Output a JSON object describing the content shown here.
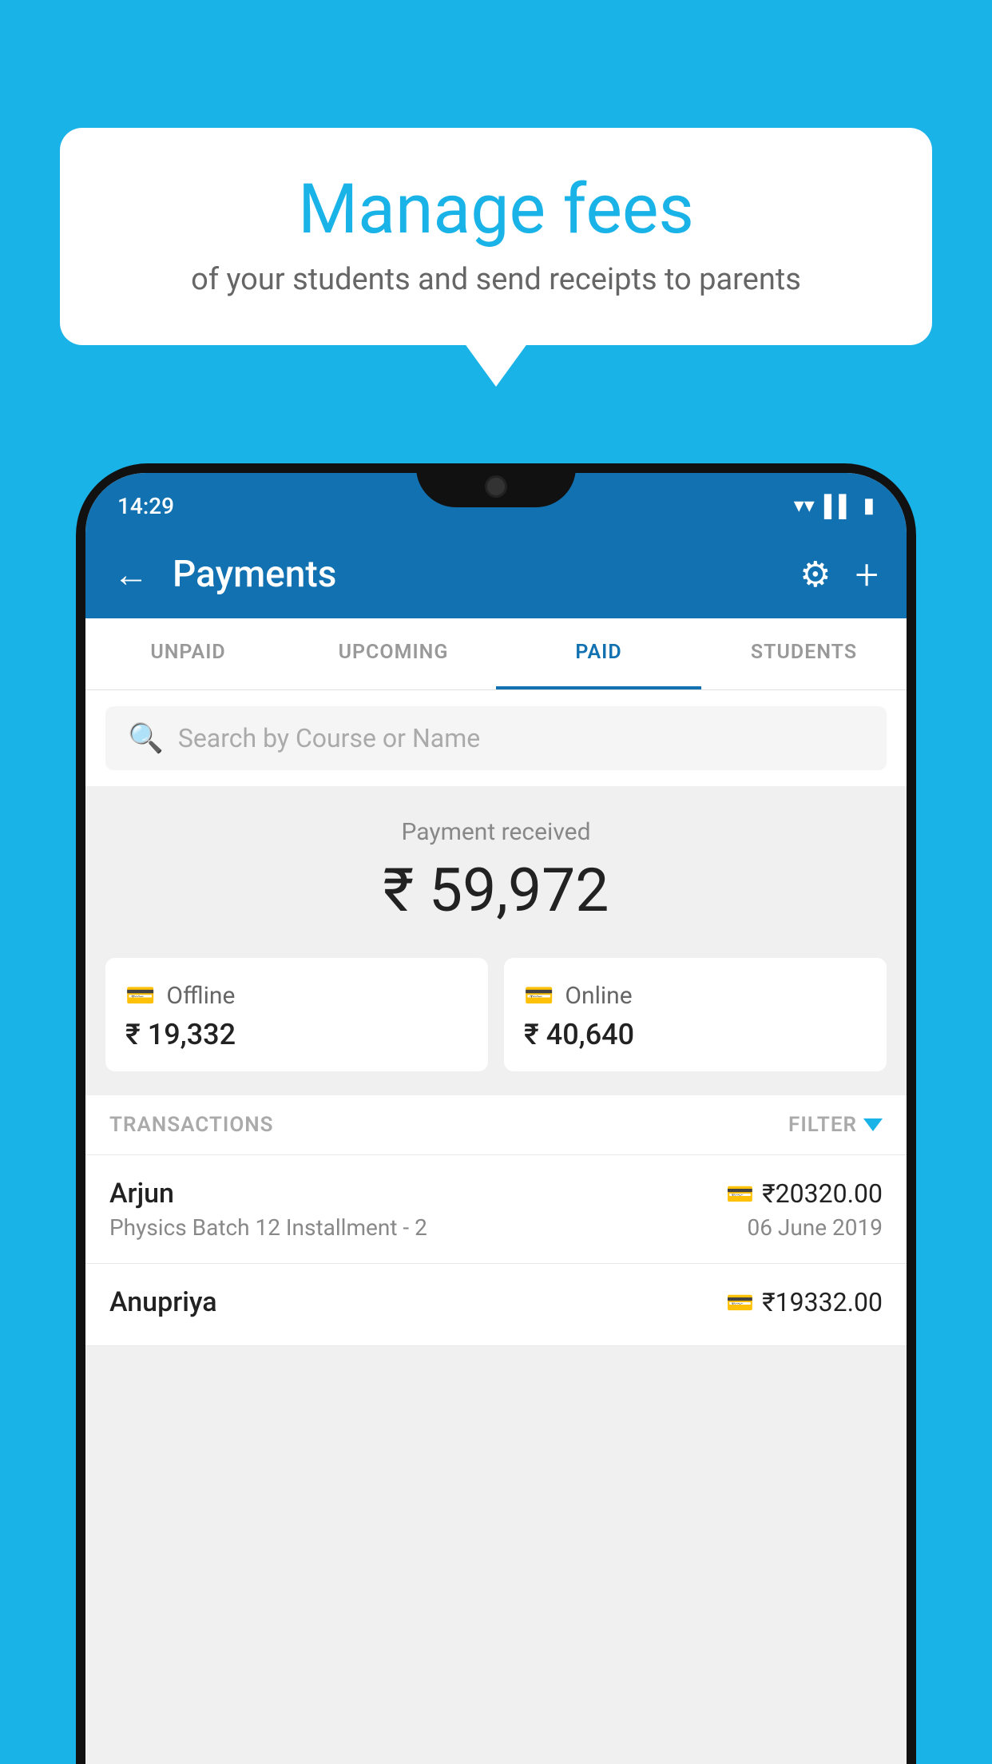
{
  "background_color": "#1ab3e8",
  "bubble": {
    "title": "Manage fees",
    "subtitle": "of your students and send receipts to parents"
  },
  "status_bar": {
    "time": "14:29",
    "icons": [
      "wifi",
      "signal",
      "battery"
    ]
  },
  "app_bar": {
    "title": "Payments",
    "back_label": "←",
    "gear_label": "⚙",
    "plus_label": "+"
  },
  "tabs": [
    {
      "label": "UNPAID",
      "active": false
    },
    {
      "label": "UPCOMING",
      "active": false
    },
    {
      "label": "PAID",
      "active": true
    },
    {
      "label": "STUDENTS",
      "active": false
    }
  ],
  "search": {
    "placeholder": "Search by Course or Name"
  },
  "payment_received": {
    "label": "Payment received",
    "amount": "₹ 59,972"
  },
  "payment_cards": [
    {
      "type": "Offline",
      "amount": "₹ 19,332",
      "icon": "💳"
    },
    {
      "type": "Online",
      "amount": "₹ 40,640",
      "icon": "💳"
    }
  ],
  "transactions": {
    "label": "TRANSACTIONS",
    "filter_label": "FILTER",
    "rows": [
      {
        "name": "Arjun",
        "course": "Physics Batch 12 Installment - 2",
        "amount": "₹20320.00",
        "date": "06 June 2019",
        "icon": "💳"
      },
      {
        "name": "Anupriya",
        "course": "",
        "amount": "₹19332.00",
        "date": "",
        "icon": "💳"
      }
    ]
  }
}
